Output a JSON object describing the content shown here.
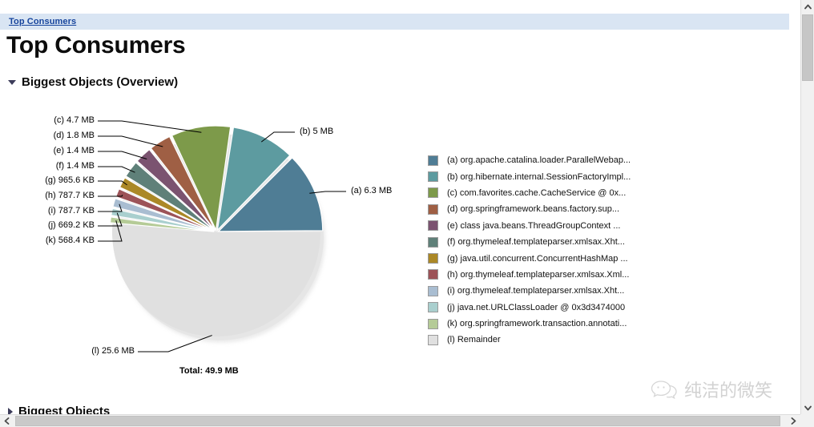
{
  "window": {
    "breadcrumb": "Top Consumers",
    "page_title": "Top Consumers"
  },
  "sections": {
    "overview": {
      "label": "Biggest Objects (Overview)",
      "state": "expanded",
      "icon": "triangle-down-icon"
    },
    "biggest_objects": {
      "label": "Biggest Objects",
      "state": "collapsed",
      "icon": "triangle-right-icon"
    }
  },
  "chart": {
    "total_label": "Total: 49.9 MB"
  },
  "watermark": {
    "text": "纯洁的微笑",
    "icon": "wechat-smile-icon"
  },
  "scrollbars": {
    "vertical": {
      "up": "▲",
      "down": "▼"
    },
    "horizontal": {
      "left": "◀",
      "right": "▶"
    }
  },
  "chart_data": {
    "type": "pie",
    "title": "Biggest Objects (Overview)",
    "total": "49.9 MB",
    "total_label": "Total: 49.9 MB",
    "units": "bytes",
    "legend_position": "right",
    "start_angle_deg": 0,
    "direction": "counter-clockwise",
    "labels": [
      "(a)",
      "(b)",
      "(c)",
      "(d)",
      "(e)",
      "(f)",
      "(g)",
      "(h)",
      "(i)",
      "(j)",
      "(k)",
      "(l)"
    ],
    "categories": [
      "org.apache.catalina.loader.ParallelWebap...",
      "org.hibernate.internal.SessionFactoryImpl...",
      "com.favorites.cache.CacheService @ 0x...",
      "org.springframework.beans.factory.sup...",
      "class java.beans.ThreadGroupContext ...",
      "org.thymeleaf.templateparser.xmlsax.Xht...",
      "java.util.concurrent.ConcurrentHashMap ...",
      "org.thymeleaf.templateparser.xmlsax.Xml...",
      "org.thymeleaf.templateparser.xmlsax.Xht...",
      "java.net.URLClassLoader @ 0x3d3474000",
      "org.springframework.transaction.annotati...",
      "Remainder"
    ],
    "value_labels": [
      "6.3 MB",
      "5 MB",
      "4.7 MB",
      "1.8 MB",
      "1.4 MB",
      "1.4 MB",
      "965.6 KB",
      "787.7 KB",
      "787.7 KB",
      "669.2 KB",
      "568.4 KB",
      "25.6 MB"
    ],
    "values_mb": [
      6.3,
      5.0,
      4.7,
      1.8,
      1.4,
      1.4,
      0.9429,
      0.7692,
      0.7692,
      0.6535,
      0.5551,
      25.6
    ],
    "colors": [
      "#4f7d95",
      "#5d9ba0",
      "#7d9a4a",
      "#9f5f44",
      "#7b5370",
      "#5f8079",
      "#ab8826",
      "#9c5358",
      "#a9bdd1",
      "#a9cfce",
      "#b5cb97",
      "#e0e0e0"
    ],
    "legend_entries": [
      {
        "key": "(a)",
        "text": "(a)  org.apache.catalina.loader.ParallelWebap...",
        "color": "#4f7d95"
      },
      {
        "key": "(b)",
        "text": "(b)  org.hibernate.internal.SessionFactoryImpl...",
        "color": "#5d9ba0"
      },
      {
        "key": "(c)",
        "text": "(c)  com.favorites.cache.CacheService @ 0x...",
        "color": "#7d9a4a"
      },
      {
        "key": "(d)",
        "text": "(d)  org.springframework.beans.factory.sup...",
        "color": "#9f5f44"
      },
      {
        "key": "(e)",
        "text": "(e)  class java.beans.ThreadGroupContext ...",
        "color": "#7b5370"
      },
      {
        "key": "(f)",
        "text": "(f)  org.thymeleaf.templateparser.xmlsax.Xht...",
        "color": "#5f8079"
      },
      {
        "key": "(g)",
        "text": "(g)  java.util.concurrent.ConcurrentHashMap ...",
        "color": "#ab8826"
      },
      {
        "key": "(h)",
        "text": "(h)  org.thymeleaf.templateparser.xmlsax.Xml...",
        "color": "#9c5358"
      },
      {
        "key": "(i)",
        "text": "(i)  org.thymeleaf.templateparser.xmlsax.Xht...",
        "color": "#a9bdd1"
      },
      {
        "key": "(j)",
        "text": "(j)  java.net.URLClassLoader @ 0x3d3474000",
        "color": "#a9cfce"
      },
      {
        "key": "(k)",
        "text": "(k)  org.springframework.transaction.annotati...",
        "color": "#b5cb97"
      },
      {
        "key": "(l)",
        "text": "(l)  Remainder",
        "color": "#e0e0e0"
      }
    ],
    "callouts": [
      {
        "key": "(a)",
        "text": "(a)  6.3 MB"
      },
      {
        "key": "(b)",
        "text": "(b)  5 MB"
      },
      {
        "key": "(c)",
        "text": "(c)  4.7 MB"
      },
      {
        "key": "(d)",
        "text": "(d)  1.8 MB"
      },
      {
        "key": "(e)",
        "text": "(e)  1.4 MB"
      },
      {
        "key": "(f)",
        "text": "(f)  1.4 MB"
      },
      {
        "key": "(g)",
        "text": "(g)  965.6 KB"
      },
      {
        "key": "(h)",
        "text": "(h)  787.7 KB"
      },
      {
        "key": "(i)",
        "text": "(i)  787.7 KB"
      },
      {
        "key": "(j)",
        "text": "(j)  669.2 KB"
      },
      {
        "key": "(k)",
        "text": "(k)  568.4 KB"
      },
      {
        "key": "(l)",
        "text": "(l)  25.6 MB"
      }
    ]
  }
}
